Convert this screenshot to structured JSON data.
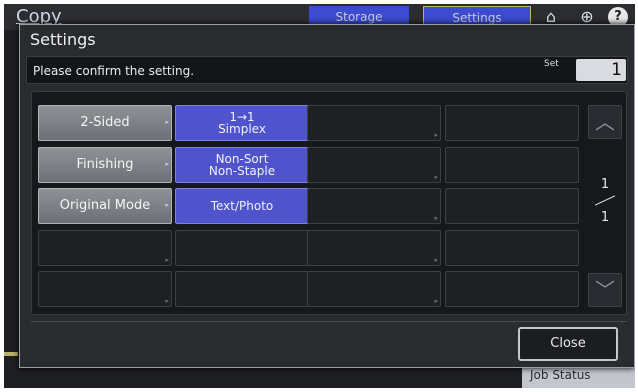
{
  "background": {
    "app_title": "Copy",
    "tabs": [
      "Storage",
      "Settings"
    ],
    "job_status": "Job Status"
  },
  "dialog": {
    "title": "Settings",
    "message": "Please confirm the setting.",
    "set_label": "Set",
    "set_value": "1",
    "rows": [
      {
        "label": "2-Sided",
        "value_line1": "1→1",
        "value_line2": "Simplex"
      },
      {
        "label": "Finishing",
        "value_line1": "Non-Sort",
        "value_line2": "Non-Staple"
      },
      {
        "label": "Original Mode",
        "value_line1": "Text/Photo",
        "value_line2": ""
      }
    ],
    "page": {
      "current": "1",
      "total": "1"
    },
    "close_label": "Close"
  },
  "icons": {
    "home": "home-icon",
    "globe": "globe-icon",
    "help": "help-icon",
    "scroll_up": "chevron-up-icon",
    "scroll_down": "chevron-down-icon"
  }
}
